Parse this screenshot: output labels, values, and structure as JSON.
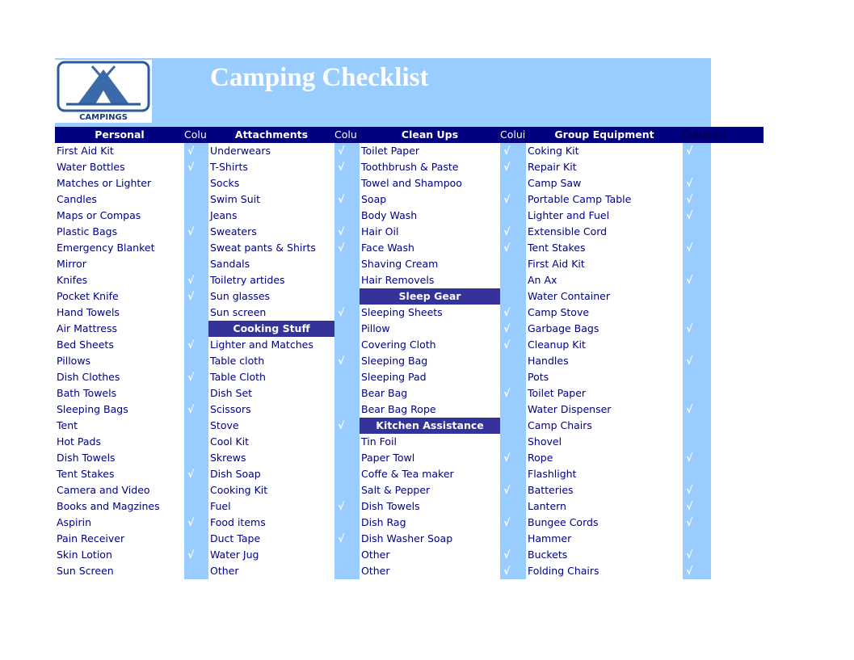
{
  "title": "Camping Checklist",
  "logo_text": "CAMPINGS",
  "colors": {
    "header_bg": "#000080",
    "banner_bg": "#99ccff",
    "section_bg": "#333399",
    "text": "#000080"
  },
  "check_icon": "√",
  "headers": [
    "Personal",
    "Colu",
    "Attachments",
    "Colu",
    "Clean Ups",
    "Colui",
    "Group Equipment",
    "Column1"
  ],
  "rows": [
    [
      "First Aid Kit",
      true,
      "Underwears",
      true,
      "Toilet Paper",
      true,
      "Coking Kit",
      true
    ],
    [
      "Water Bottles",
      true,
      "T-Shirts",
      true,
      "Toothbrush & Paste",
      true,
      "Repair Kit",
      false
    ],
    [
      "Matches or Lighter",
      false,
      "Socks",
      false,
      "Towel and Shampoo",
      false,
      "Camp Saw",
      true
    ],
    [
      "Candles",
      false,
      "Swim Suit",
      true,
      "Soap",
      true,
      "Portable Camp Table",
      true
    ],
    [
      "Maps or Compas",
      false,
      "Jeans",
      false,
      "Body Wash",
      false,
      "Lighter and Fuel",
      true
    ],
    [
      "Plastic Bags",
      true,
      "Sweaters",
      true,
      "Hair Oil",
      true,
      "Extensible Cord",
      false
    ],
    [
      "Emergency Blanket",
      false,
      "Sweat pants & Shirts",
      true,
      "Face Wash",
      true,
      "Tent Stakes",
      true
    ],
    [
      "Mirror",
      false,
      "Sandals",
      false,
      "Shaving Cream",
      false,
      "First Aid Kit",
      false
    ],
    [
      "Knifes",
      true,
      "Toiletry artides",
      false,
      "Hair Removels",
      false,
      "An Ax",
      true
    ],
    [
      "Pocket Knife",
      true,
      "Sun glasses",
      false,
      {
        "section": "Sleep Gear"
      },
      false,
      "Water Container",
      false
    ],
    [
      "Hand Towels",
      false,
      "Sun screen",
      true,
      "Sleeping Sheets",
      true,
      "Camp Stove",
      false
    ],
    [
      "Air Mattress",
      false,
      {
        "section": "Cooking Stuff"
      },
      false,
      "Pillow",
      true,
      "Garbage Bags",
      true
    ],
    [
      "Bed Sheets",
      true,
      "Lighter and Matches",
      false,
      "Covering Cloth",
      true,
      "Cleanup Kit",
      false
    ],
    [
      "Pillows",
      false,
      "Table cloth",
      true,
      "Sleeping Bag",
      false,
      "Handles",
      true
    ],
    [
      "Dish Clothes",
      true,
      "Table Cloth",
      false,
      "Sleeping Pad",
      false,
      "Pots",
      false
    ],
    [
      "Bath Towels",
      false,
      "Dish Set",
      false,
      "Bear Bag",
      true,
      "Toilet Paper",
      false
    ],
    [
      "Sleeping Bags",
      true,
      "Scissors",
      false,
      "Bear Bag Rope",
      false,
      "Water Dispenser",
      true
    ],
    [
      "Tent",
      false,
      "Stove",
      true,
      {
        "section": "Kitchen Assistance"
      },
      false,
      "Camp Chairs",
      false
    ],
    [
      "Hot Pads",
      false,
      "Cool Kit",
      false,
      "Tin Foil",
      false,
      "Shovel",
      false
    ],
    [
      "Dish Towels",
      false,
      "Skrews",
      false,
      "Paper Towl",
      true,
      "Rope",
      true
    ],
    [
      "Tent Stakes",
      true,
      "Dish Soap",
      false,
      "Coffe & Tea maker",
      false,
      "Flashlight",
      false
    ],
    [
      "Camera and Video",
      false,
      "Cooking Kit",
      false,
      "Salt & Pepper",
      true,
      "Batteries",
      true
    ],
    [
      "Books and Magzines",
      false,
      "Fuel",
      true,
      "Dish Towels",
      false,
      "Lantern",
      true
    ],
    [
      "Aspirin",
      true,
      "Food items",
      false,
      "Dish Rag",
      true,
      "Bungee Cords",
      true
    ],
    [
      "Pain Receiver",
      false,
      "Duct Tape",
      true,
      "Dish Washer Soap",
      false,
      "Hammer",
      false
    ],
    [
      "Skin Lotion",
      true,
      "Water Jug",
      false,
      "Other",
      true,
      "Buckets",
      true
    ],
    [
      "Sun Screen",
      false,
      "Other",
      false,
      "Other",
      true,
      "Folding Chairs",
      true
    ]
  ]
}
